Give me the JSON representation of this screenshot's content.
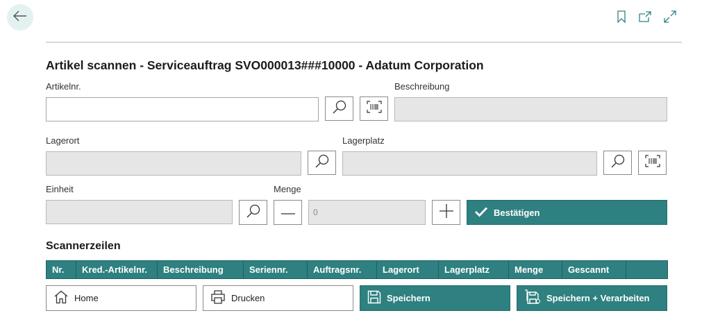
{
  "header": {
    "back_icon": "arrow-left-icon",
    "bookmark_icon": "bookmark-icon",
    "open_new_icon": "open-in-new-window-icon",
    "expand_icon": "expand-icon"
  },
  "page": {
    "title": "Artikel scannen - Serviceauftrag SVO000013###10000 - Adatum Corporation"
  },
  "form": {
    "item_no": {
      "label": "Artikelnr.",
      "value": ""
    },
    "description": {
      "label": "Beschreibung",
      "value": ""
    },
    "location": {
      "label": "Lagerort",
      "value": ""
    },
    "bin": {
      "label": "Lagerplatz",
      "value": ""
    },
    "unit": {
      "label": "Einheit",
      "value": ""
    },
    "quantity": {
      "label": "Menge",
      "value": "0"
    },
    "lookup_icon": "magnifier-icon",
    "scan_icon": "barcode-scan-icon",
    "minus_icon": "minus-icon",
    "plus_icon": "plus-icon",
    "confirm_label": "Bestätigen",
    "confirm_icon": "checkmark-icon"
  },
  "scan_lines": {
    "title": "Scannerzeilen",
    "columns": [
      "Nr.",
      "Kred.-Artikelnr.",
      "Beschreibung",
      "Seriennr.",
      "Auftragsnr.",
      "Lagerort",
      "Lagerplatz",
      "Menge",
      "Gescannt",
      ""
    ],
    "rows": []
  },
  "actions": {
    "home": "Home",
    "print": "Drucken",
    "save": "Speichern",
    "save_process": "Speichern + Verarbeiten"
  },
  "colors": {
    "accent": "#2f8080",
    "back_button_bg": "#e3f1f1"
  }
}
